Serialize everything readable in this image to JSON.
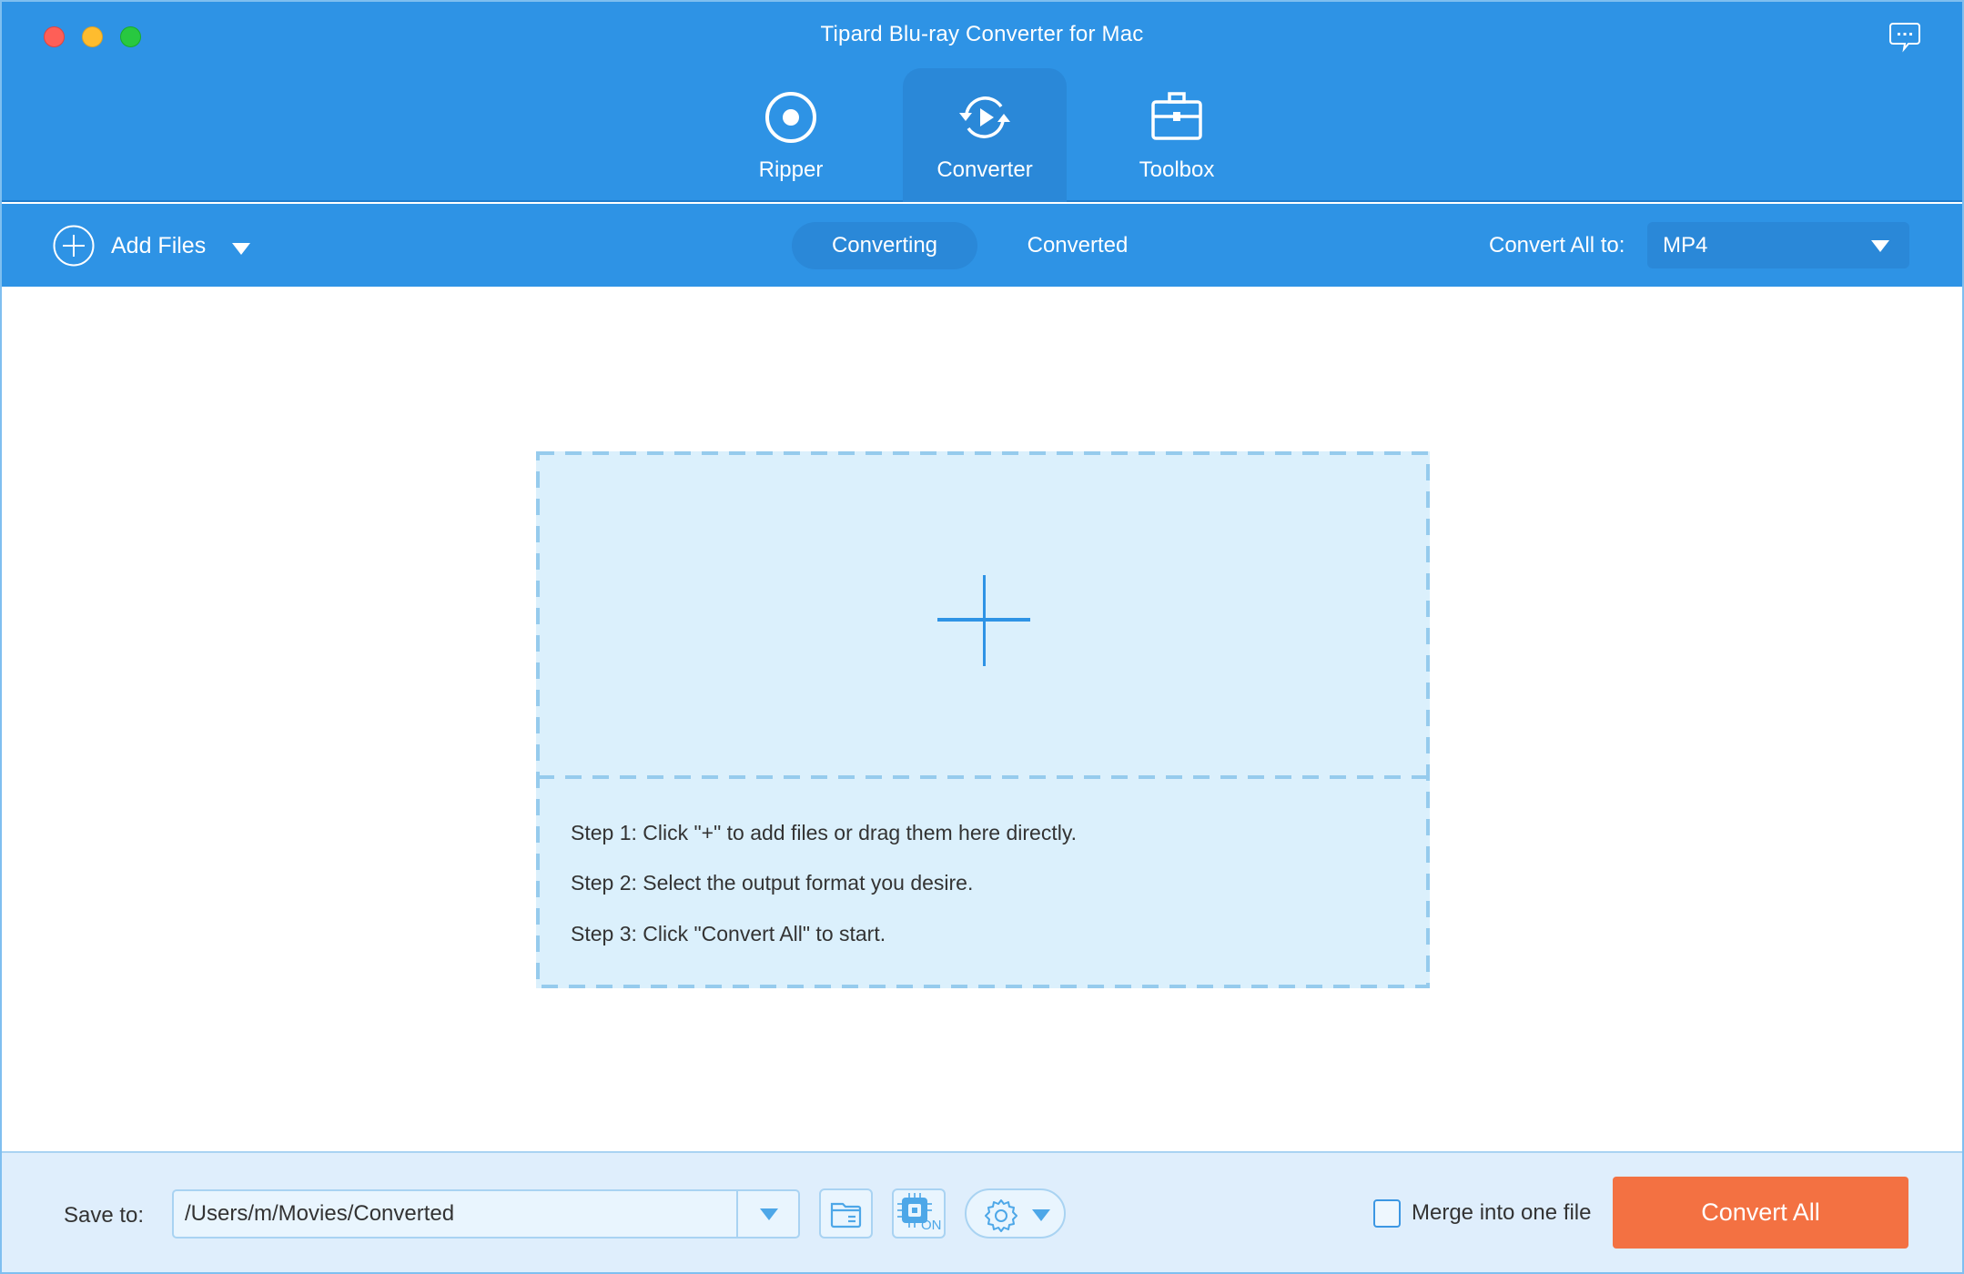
{
  "window": {
    "title": "Tipard Blu-ray Converter for Mac"
  },
  "header": {
    "feedback_icon": "chat-bubble-icon",
    "tabs": [
      {
        "label": "Ripper",
        "icon": "disc-record-icon",
        "active": false
      },
      {
        "label": "Converter",
        "icon": "convert-cycle-icon",
        "active": true
      },
      {
        "label": "Toolbox",
        "icon": "toolbox-icon",
        "active": false
      }
    ]
  },
  "toolbar": {
    "add_files_label": "Add Files",
    "add_files_icon": "plus-circle-icon",
    "subtabs": [
      {
        "label": "Converting",
        "active": true
      },
      {
        "label": "Converted",
        "active": false
      }
    ],
    "convert_all_to_label": "Convert All to:",
    "format_value": "MP4"
  },
  "dropzone": {
    "plus_icon": "plus-icon",
    "steps": [
      "Step 1: Click \"+\" to add files or drag them here directly.",
      "Step 2: Select the output format you desire.",
      "Step 3: Click \"Convert All\" to start."
    ]
  },
  "footer": {
    "save_to_label": "Save to:",
    "save_path": "/Users/m/Movies/Converted",
    "gpu_badge": "ON",
    "merge_label": "Merge into one file",
    "merge_checked": false,
    "convert_all_button": "Convert All"
  },
  "colors": {
    "header_blue": "#2e93e5",
    "active_tab_blue": "#2a88d8",
    "dropzone_fill": "#dbf0fc",
    "footer_fill": "#dfeefc",
    "accent_orange": "#f37142"
  }
}
